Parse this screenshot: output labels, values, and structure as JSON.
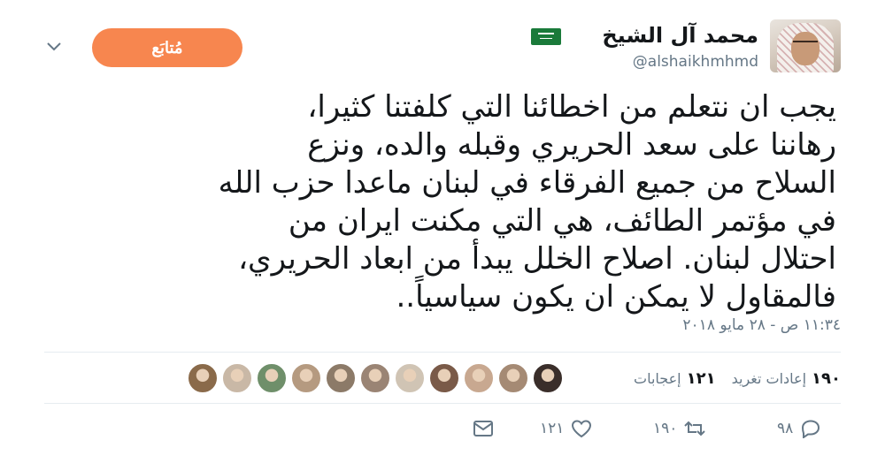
{
  "header": {
    "name": "محمد آل الشيخ",
    "handle": "@alshaikhmhmd",
    "follow_label": "مُتابَع"
  },
  "body": {
    "lines": [
      "يجب ان نتعلم من اخطائنا التي كلفتنا كثيرا،",
      "رهاننا على سعد الحريري وقبله والده، ونزع",
      "السلاح من جميع الفرقاء في لبنان ماعدا حزب الله",
      "في مؤتمر الطائف، هي التي مكنت ايران من",
      "احتلال لبنان. اصلاح الخلل يبدأ من ابعاد الحريري،",
      "فالمقاول لا يمكن ان يكون سياسياً.."
    ]
  },
  "timestamp": "١١:٣٤ ص - ٢٨ مايو ٢٠١٨",
  "stats": {
    "retweets_count": "١٩٠",
    "retweets_label": "إعادات تغريد",
    "likes_count": "١٢١",
    "likes_label": "إعجابات"
  },
  "liker_avatars": [
    "#8a6a4a",
    "#c9b8a6",
    "#6f8f6a",
    "#b59a80",
    "#8c7a68",
    "#9a8474",
    "#d0c4b4",
    "#7a5a48",
    "#c8a890",
    "#a58a74",
    "#3a2e2a"
  ],
  "actions": {
    "reply_count": "٩٨",
    "retweet_count": "١٩٠",
    "like_count": "١٢١"
  },
  "colors": {
    "accent": "#f7864f",
    "muted": "#657786",
    "flag_green": "#1a7a3a"
  },
  "icons": [
    "chevron-down-icon",
    "reply-icon",
    "retweet-icon",
    "like-icon",
    "message-icon",
    "saudi-flag-icon"
  ]
}
